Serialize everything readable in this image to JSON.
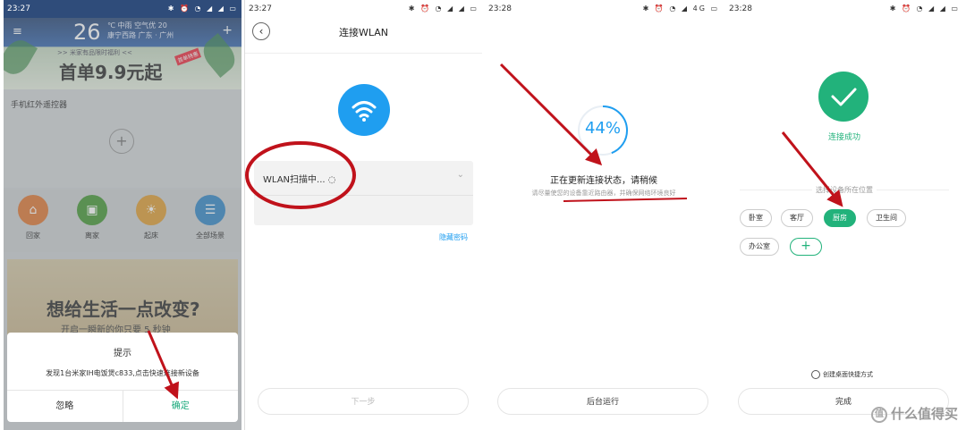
{
  "panel1": {
    "status": {
      "time": "23:27"
    },
    "weather": {
      "temp": "26",
      "line1": "℃ 中雨 空气优 20",
      "line2": "康宁西路 广东 · 广州"
    },
    "promo": {
      "small": ">> 米家有品限时福利 <<",
      "big": "首单9.9元起",
      "badge": "首单特惠"
    },
    "device_section_label": "手机红外遥控器",
    "scenes": [
      {
        "label": "回家",
        "icon": "home-icon",
        "color": "#e07b39"
      },
      {
        "label": "离家",
        "icon": "briefcase-icon",
        "color": "#4a9a3a"
      },
      {
        "label": "起床",
        "icon": "sunrise-icon",
        "color": "#e0a03a"
      },
      {
        "label": "全部场景",
        "icon": "list-icon",
        "color": "#3a8ac8"
      }
    ],
    "banner2": {
      "title": "想给生活一点改变?",
      "subtitle": "开启一瞬新的你只要 5 秒钟"
    },
    "dialog": {
      "title": "提示",
      "message": "发现1台米家IH电饭煲c833,点击快速连接新设备",
      "ignore": "忽略",
      "confirm": "确定"
    }
  },
  "panel2": {
    "status": {
      "time": "23:27"
    },
    "title": "连接WLAN",
    "scan_label": "WLAN扫描中...",
    "hide_password": "隐藏密码",
    "next_button": "下一步"
  },
  "panel3": {
    "status": {
      "time": "23:28"
    },
    "progress_percent_label": "44%",
    "progress_fraction": 0.44,
    "status_text": "正在更新连接状态，请稍候",
    "hint_text": "请尽量使您的设备靠近路由器，并确保网络环境良好",
    "background_button": "后台运行"
  },
  "panel4": {
    "status": {
      "time": "23:28"
    },
    "success_text": "连接成功",
    "location_label": "选择设备所在位置",
    "rooms": [
      {
        "label": "卧室",
        "selected": false
      },
      {
        "label": "客厅",
        "selected": false
      },
      {
        "label": "厨房",
        "selected": true
      },
      {
        "label": "卫生间",
        "selected": false
      },
      {
        "label": "办公室",
        "selected": false
      }
    ],
    "shortcut_label": "创建桌面快捷方式",
    "done_button": "完成"
  },
  "watermark": {
    "badge": "值",
    "text": "什么值得买"
  },
  "colors": {
    "accent_green": "#22b27b",
    "accent_blue": "#1f9ef0",
    "annotation_red": "#c0121b"
  }
}
